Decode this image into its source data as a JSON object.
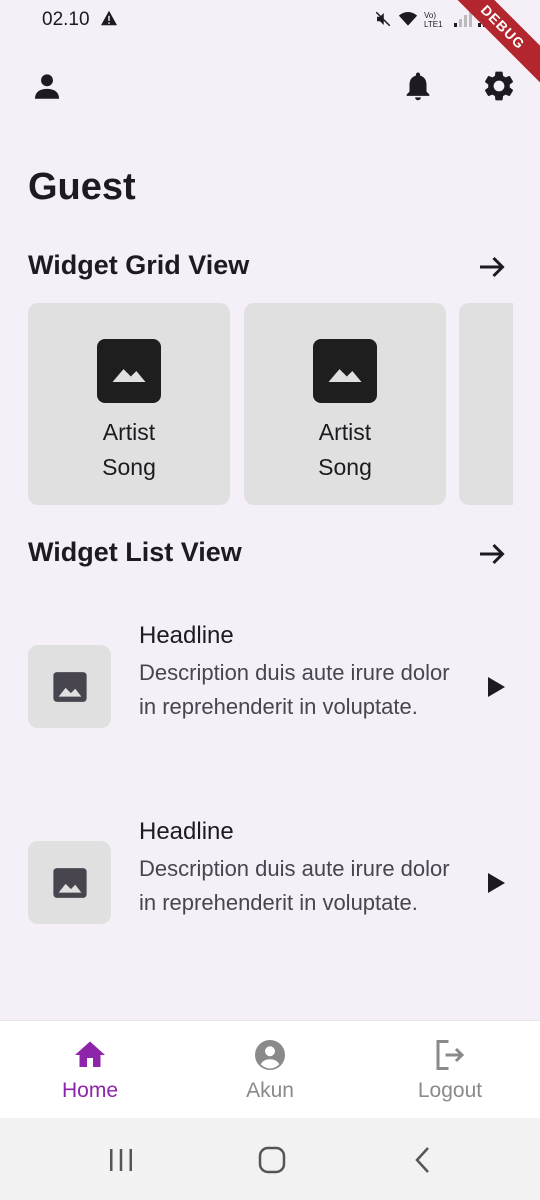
{
  "status_bar": {
    "time": "02.10",
    "debug": "DEBUG"
  },
  "page": {
    "title": "Guest"
  },
  "grid_section": {
    "title": "Widget Grid View",
    "cards": [
      {
        "line1": "Artist",
        "line2": "Song"
      },
      {
        "line1": "Artist",
        "line2": "Song"
      }
    ]
  },
  "list_section": {
    "title": "Widget List View",
    "items": [
      {
        "headline": "Headline",
        "description": "Description duis aute irure dolor in reprehenderit in voluptate."
      },
      {
        "headline": "Headline",
        "description": "Description duis aute irure dolor in reprehenderit in voluptate."
      }
    ]
  },
  "bottom_nav": {
    "items": [
      {
        "label": "Home",
        "icon": "home-icon",
        "active": true
      },
      {
        "label": "Akun",
        "icon": "account-circle-icon",
        "active": false
      },
      {
        "label": "Logout",
        "icon": "logout-icon",
        "active": false
      }
    ]
  },
  "colors": {
    "accent": "#8e24aa",
    "inactive": "#8a8a8a",
    "background": "#f5eff7",
    "card": "#e0e0e0"
  }
}
